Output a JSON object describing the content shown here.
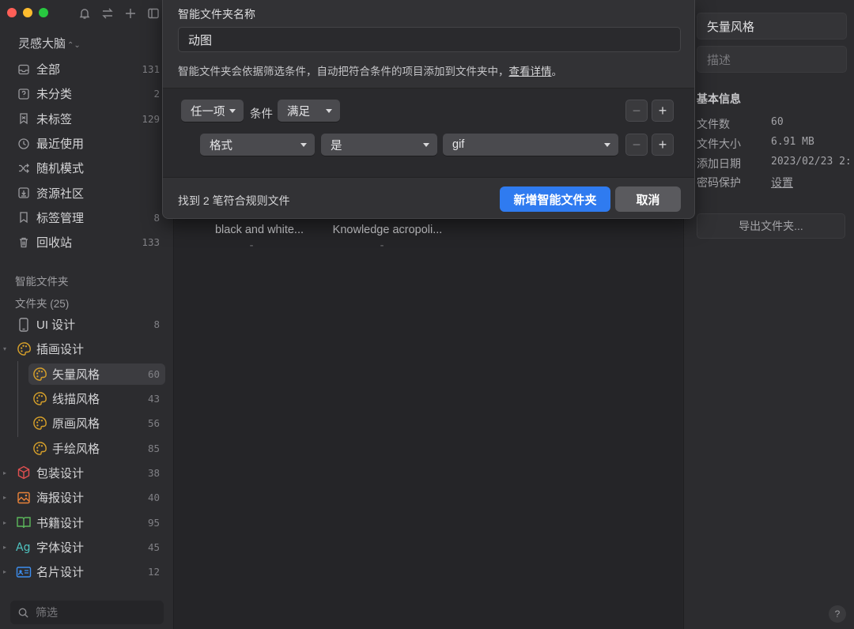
{
  "sidebar": {
    "library_title": "灵感大脑",
    "nav": [
      {
        "label": "全部",
        "count": "131",
        "icon": "inbox-icon"
      },
      {
        "label": "未分类",
        "count": "2",
        "icon": "question-box-icon"
      },
      {
        "label": "未标签",
        "count": "129",
        "icon": "untagged-icon"
      },
      {
        "label": "最近使用",
        "count": "",
        "icon": "clock-icon"
      },
      {
        "label": "随机模式",
        "count": "",
        "icon": "shuffle-icon"
      },
      {
        "label": "资源社区",
        "count": "",
        "icon": "download-box-icon"
      },
      {
        "label": "标签管理",
        "count": "8",
        "icon": "bookmark-icon"
      },
      {
        "label": "回收站",
        "count": "133",
        "icon": "trash-icon"
      }
    ],
    "smart_folders_title": "智能文件夹",
    "folders_title": "文件夹 (25)",
    "folders": [
      {
        "label": "UI 设计",
        "count": "8",
        "icon": "phone-icon"
      },
      {
        "label": "插画设计",
        "count": "",
        "icon": "palette-icon"
      },
      {
        "label": "矢量风格",
        "count": "60",
        "icon": "palette-icon"
      },
      {
        "label": "线描风格",
        "count": "43",
        "icon": "palette-icon"
      },
      {
        "label": "原画风格",
        "count": "56",
        "icon": "palette-icon"
      },
      {
        "label": "手绘风格",
        "count": "85",
        "icon": "palette-icon"
      },
      {
        "label": "包装设计",
        "count": "38",
        "icon": "box-icon"
      },
      {
        "label": "海报设计",
        "count": "40",
        "icon": "image-icon"
      },
      {
        "label": "书籍设计",
        "count": "95",
        "icon": "book-icon"
      },
      {
        "label": "字体设计",
        "count": "45",
        "icon": "font-icon"
      },
      {
        "label": "名片设计",
        "count": "12",
        "icon": "card-icon"
      }
    ],
    "filter_placeholder": "筛选"
  },
  "main": {
    "card1_line1": "black and white...",
    "card1_line2": "-",
    "card2_line1": "Knowledge acropoli...",
    "card2_line2": "-"
  },
  "right": {
    "title": "矢量风格",
    "desc_placeholder": "描述",
    "section": "基本信息",
    "info": [
      {
        "k": "文件数",
        "v": "60"
      },
      {
        "k": "文件大小",
        "v": "6.91 MB"
      },
      {
        "k": "添加日期",
        "v": "2023/02/23 2:"
      },
      {
        "k": "密码保护",
        "v": "设置"
      }
    ],
    "export_label": "导出文件夹...",
    "help": "?"
  },
  "dialog": {
    "name_label": "智能文件夹名称",
    "name_value": "动图",
    "desc": "智能文件夹会依据筛选条件，自动把符合条件的项目添加到文件夹中，",
    "desc_link": "查看详情",
    "desc_end": "。",
    "match_any": "任一项",
    "condition_text": "条件",
    "match_mode": "满足",
    "rule_field": "格式",
    "rule_op": "是",
    "rule_value": "gif",
    "minus": "−",
    "plus": "+",
    "found_text": "找到 2 笔符合规则文件",
    "create_label": "新增智能文件夹",
    "cancel_label": "取消"
  }
}
